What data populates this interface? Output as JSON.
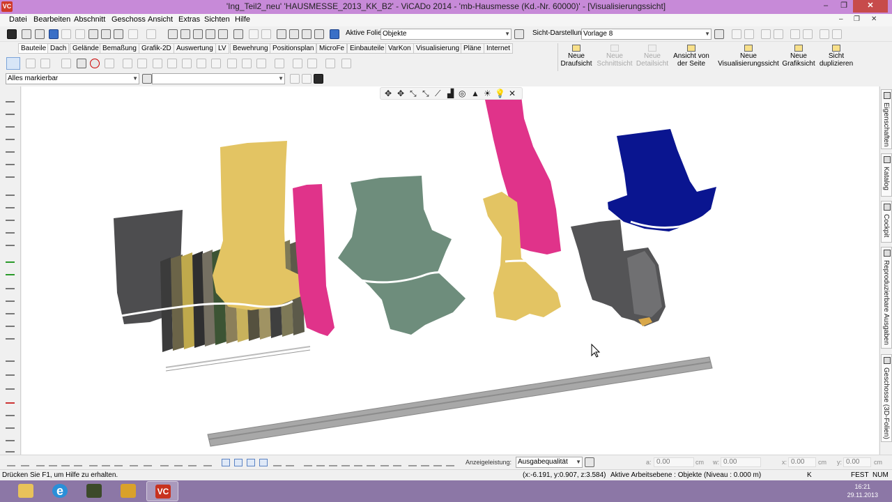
{
  "window": {
    "logo": "VC",
    "title": "'Ing_Teil2_neu' 'HAUSMESSE_2013_KK_B2' - ViCADo 2014 - 'mb-Hausmesse (Kd.-Nr. 60000)' - [Visualisierungssicht]",
    "min_glyph": "–",
    "max_glyph": "❐",
    "close_glyph": "✕"
  },
  "menu": {
    "items": [
      "Datei",
      "Bearbeiten",
      "Abschnitt",
      "Geschoss",
      "Ansicht",
      "Extras",
      "Sichten",
      "Hilfe"
    ],
    "doc_min": "–",
    "doc_restore": "❐",
    "doc_close": "✕"
  },
  "toolbar": {
    "active_folie_label": "Aktive Folie:",
    "active_folie_value": "Objekte",
    "sicht_label": "Sicht-Darstellung:",
    "sicht_value": "Vorlage 8"
  },
  "tabs": [
    "Bauteile",
    "Dach",
    "Gelände",
    "Bemaßung",
    "Grafik-2D",
    "Auswertung",
    "LV",
    "Bewehrung",
    "Positionsplan",
    "MicroFe",
    "Einbauteile",
    "VarKon",
    "Visualisierung",
    "Pläne",
    "Internet"
  ],
  "commands": [
    {
      "line1": "Neue",
      "line2": "Draufsicht",
      "enabled": true
    },
    {
      "line1": "Neue",
      "line2": "Schnittsicht",
      "enabled": false
    },
    {
      "line1": "Neue",
      "line2": "Detailsicht",
      "enabled": false
    },
    {
      "line1": "Ansicht von",
      "line2": "der Seite",
      "enabled": true
    },
    {
      "line1": "Neue",
      "line2": "Visualisierungssicht",
      "enabled": true
    },
    {
      "line1": "Neue",
      "line2": "Grafiksicht",
      "enabled": true
    },
    {
      "line1": "Sicht",
      "line2": "duplizieren",
      "enabled": true
    }
  ],
  "filter": {
    "selection_value": "Alles markierbar",
    "second_value": ""
  },
  "nav3d_glyphs": [
    "✥",
    "✥",
    "⤡",
    "⤡",
    "⟋",
    "▟",
    "◎",
    "▲",
    "☀",
    "💡",
    "✕"
  ],
  "sidetabs": [
    "Eigenschaften",
    "Katalog",
    "Cockpit",
    "Reproduzierbare Ausgaben",
    "Geschosse (3D-Folien)"
  ],
  "bottom": {
    "anzeige_label": "Anzeigeleistung:",
    "anzeige_value": "Ausgabequalität",
    "coords": [
      {
        "label": "a:",
        "value": "0.00",
        "unit": "cm"
      },
      {
        "label": "w:",
        "value": "0.00",
        "unit": ""
      },
      {
        "label": "x:",
        "value": "0.00",
        "unit": "cm"
      },
      {
        "label": "y:",
        "value": "0.00",
        "unit": "cm"
      }
    ]
  },
  "status": {
    "help": "Drücken Sie F1, um Hilfe zu erhalten.",
    "coords": "(x:-6.191, y:0.907, z:3.584)",
    "arbeitsebene": "Aktive Arbeitsebene : Objekte (Niveau : 0.000 m)",
    "k": "K",
    "fest": "FEST",
    "num": "NUM"
  },
  "taskbar": {
    "time": "16:21",
    "date": "29.11.2013",
    "vc_label": "VC",
    "ie_label": "e"
  },
  "colors": {
    "titlebar": "#c78ad8",
    "taskbar": "#8c77a6",
    "gray_shape": "#4d4d4f",
    "yellow_shape": "#e3c463",
    "pink_shape": "#e0338a",
    "green_shape": "#6e8d7c",
    "blue_shape": "#0a1590",
    "beam": "#a8a8a8"
  }
}
